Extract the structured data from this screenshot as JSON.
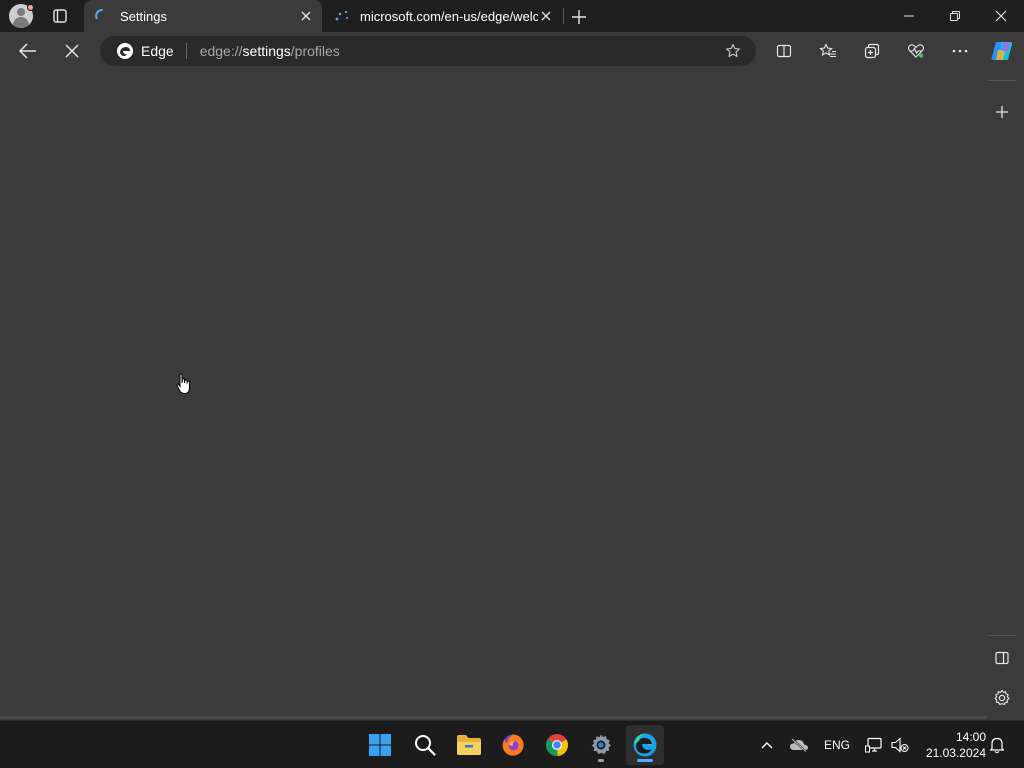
{
  "window": {
    "tabs": [
      {
        "title": "Settings",
        "state": "loading",
        "active": true
      },
      {
        "title": "microsoft.com/en-us/edge/welc",
        "state": "loading",
        "active": false
      }
    ]
  },
  "toolbar": {
    "brand": "Edge",
    "url_scheme": "edge://",
    "url_host": "settings",
    "url_path": "/profiles"
  },
  "taskbar": {
    "apps": [
      "start",
      "search",
      "file-explorer",
      "firefox",
      "chrome",
      "settings",
      "edge"
    ],
    "language": "ENG",
    "time": "14:00",
    "date": "21.03.2024"
  },
  "colors": {
    "background": "#3b3b3b",
    "tabstrip": "#1f1f1f",
    "accent": "#5ca8ff"
  }
}
